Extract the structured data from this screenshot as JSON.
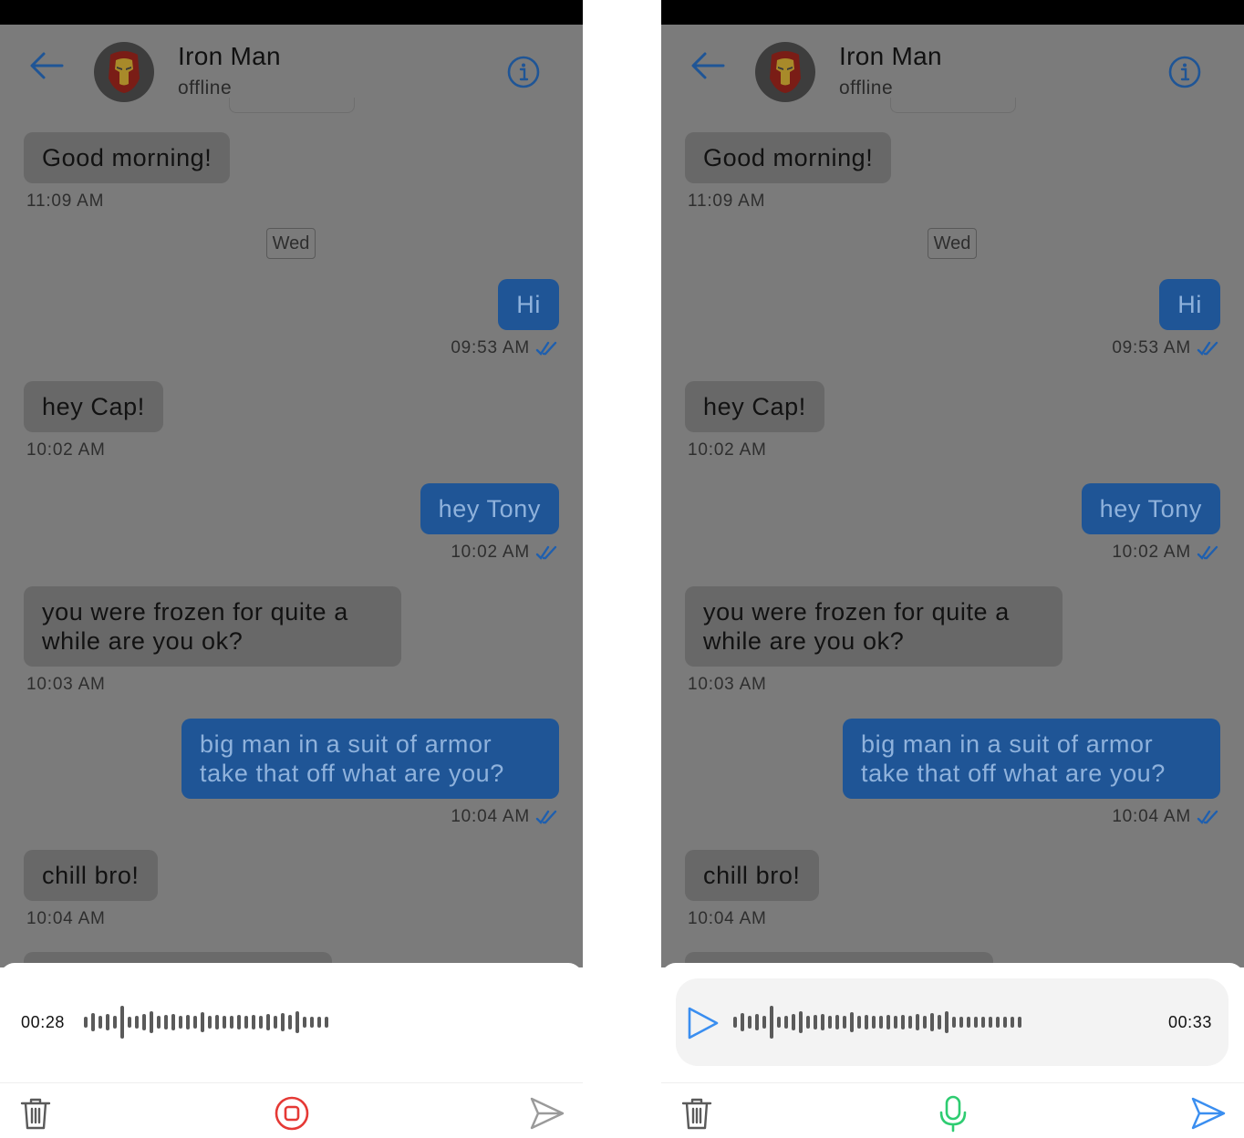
{
  "contact": {
    "name": "Iron Man",
    "status": "offline"
  },
  "messages": [
    {
      "side": "in",
      "text": "Good morning!",
      "time": "11:09 AM"
    },
    {
      "side": "day",
      "text": "Wed"
    },
    {
      "side": "out",
      "text": "Hi",
      "time": "09:53 AM",
      "read": true
    },
    {
      "side": "in",
      "text": "hey Cap!",
      "time": "10:02 AM"
    },
    {
      "side": "out",
      "text": "hey Tony",
      "time": "10:02 AM",
      "read": true
    },
    {
      "side": "in",
      "lines": [
        "you were frozen for quite a",
        "while are you ok?"
      ],
      "time": "10:03 AM"
    },
    {
      "side": "out",
      "lines": [
        "big man in a suit of armor",
        "take that off what are you?"
      ],
      "time": "10:04 AM",
      "read": true
    },
    {
      "side": "in",
      "text": "chill bro!",
      "time": "10:04 AM"
    }
  ],
  "recording_screen": {
    "timer": "00:28",
    "icons": {
      "delete": "trash-icon",
      "stop": "stop-record-icon",
      "send": "send-icon"
    }
  },
  "playback_screen": {
    "duration": "00:33",
    "icons": {
      "play": "play-icon",
      "delete": "trash-icon",
      "mic": "microphone-icon",
      "send": "send-icon"
    }
  },
  "colors": {
    "outgoing_bubble": "#1f5596",
    "read_tick": "#1f5fae",
    "stop_red": "#e53935",
    "mic_green": "#2ecc71",
    "send_active": "#3a8ef0",
    "play_blue": "#3a8ef0"
  }
}
